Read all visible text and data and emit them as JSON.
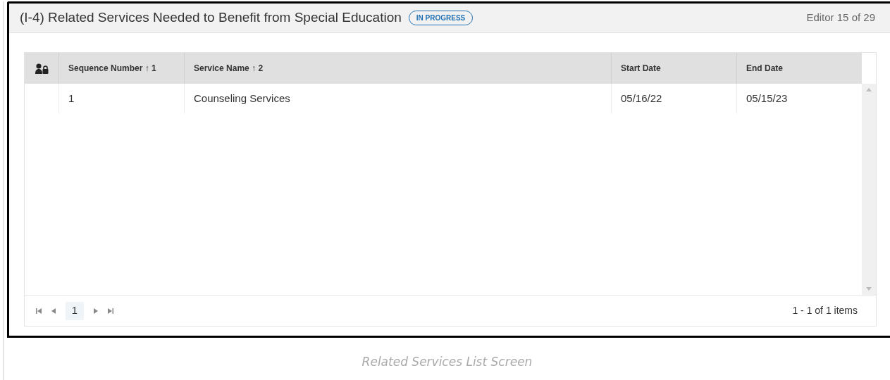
{
  "panel": {
    "title": "(I-4) Related Services Needed to Benefit from Special Education",
    "status_badge": "IN PROGRESS",
    "editor_position": "Editor 15 of 29"
  },
  "table": {
    "columns": [
      {
        "kind": "icon"
      },
      {
        "kind": "text",
        "label": "Sequence Number ↑ 1"
      },
      {
        "kind": "text",
        "label": "Service Name ↑ 2"
      },
      {
        "kind": "text",
        "label": "Start Date"
      },
      {
        "kind": "text",
        "label": "End Date"
      }
    ],
    "rows": [
      {
        "cells": [
          "",
          "1",
          "Counseling Services",
          "05/16/22",
          "05/15/23"
        ]
      }
    ]
  },
  "pager": {
    "pages": [
      {
        "label": "1",
        "selected": true
      }
    ],
    "summary": "1 - 1 of 1 items"
  },
  "caption": "Related Services List Screen"
}
